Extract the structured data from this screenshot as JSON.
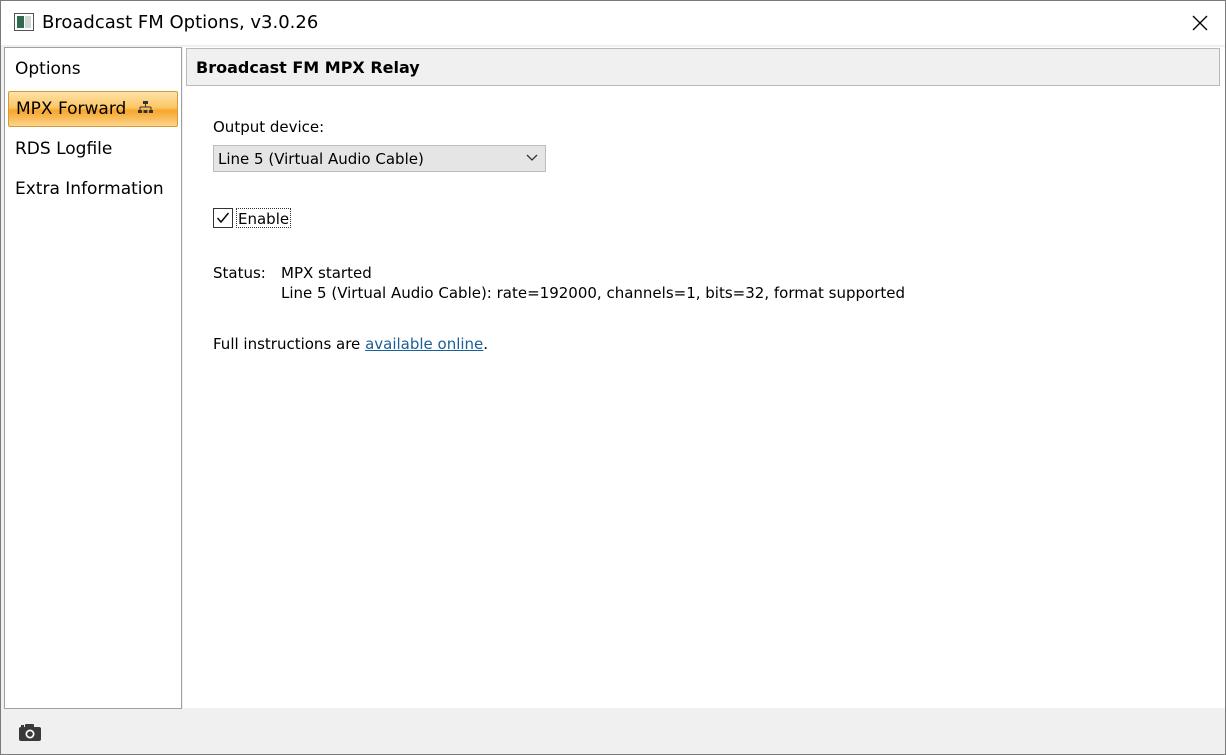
{
  "window": {
    "title": "Broadcast FM Options, v3.0.26"
  },
  "sidebar": {
    "items": [
      {
        "label": "Options"
      },
      {
        "label": "MPX Forward"
      },
      {
        "label": "RDS Logfile"
      },
      {
        "label": "Extra Information"
      }
    ],
    "selected": "MPX Forward"
  },
  "main": {
    "header": "Broadcast FM MPX Relay",
    "output_device_label": "Output device:",
    "output_device_value": "Line 5 (Virtual Audio Cable)",
    "enable_label": "Enable",
    "enable_checked": true,
    "status_label": "Status:",
    "status_line1": "MPX started",
    "status_line2": "Line 5 (Virtual Audio Cable): rate=192000, channels=1, bits=32, format supported",
    "instructions_prefix": "Full instructions are ",
    "instructions_link": "available online",
    "instructions_suffix": "."
  },
  "icons": {
    "app": "app-icon",
    "close": "close-icon",
    "network": "network-icon",
    "chevron": "chevron-down-icon",
    "check": "checkmark-icon",
    "camera": "camera-icon"
  },
  "colors": {
    "selection": "#fbc766",
    "link": "#1a5f96"
  }
}
